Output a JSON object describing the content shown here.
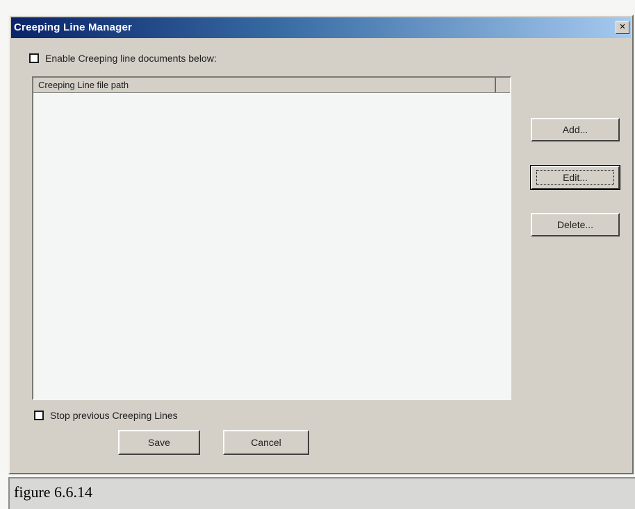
{
  "window": {
    "title": "Creeping Line Manager",
    "close_glyph": "×",
    "close_icon": "close-icon"
  },
  "enable_checkbox": {
    "label": "Enable Creeping line documents below:",
    "checked": false
  },
  "list": {
    "column_header": "Creeping Line file path",
    "rows": []
  },
  "buttons": {
    "add": "Add...",
    "edit": "Edit...",
    "delete": "Delete...",
    "save": "Save",
    "cancel": "Cancel"
  },
  "stop_checkbox": {
    "label": "Stop previous Creeping Lines",
    "checked": false
  },
  "caption": "figure 6.6.14",
  "colors": {
    "dialog_face": "#d4d0c8",
    "titlebar_start": "#0a246a",
    "titlebar_end": "#a6caf0",
    "list_background": "#f4f5f5"
  }
}
